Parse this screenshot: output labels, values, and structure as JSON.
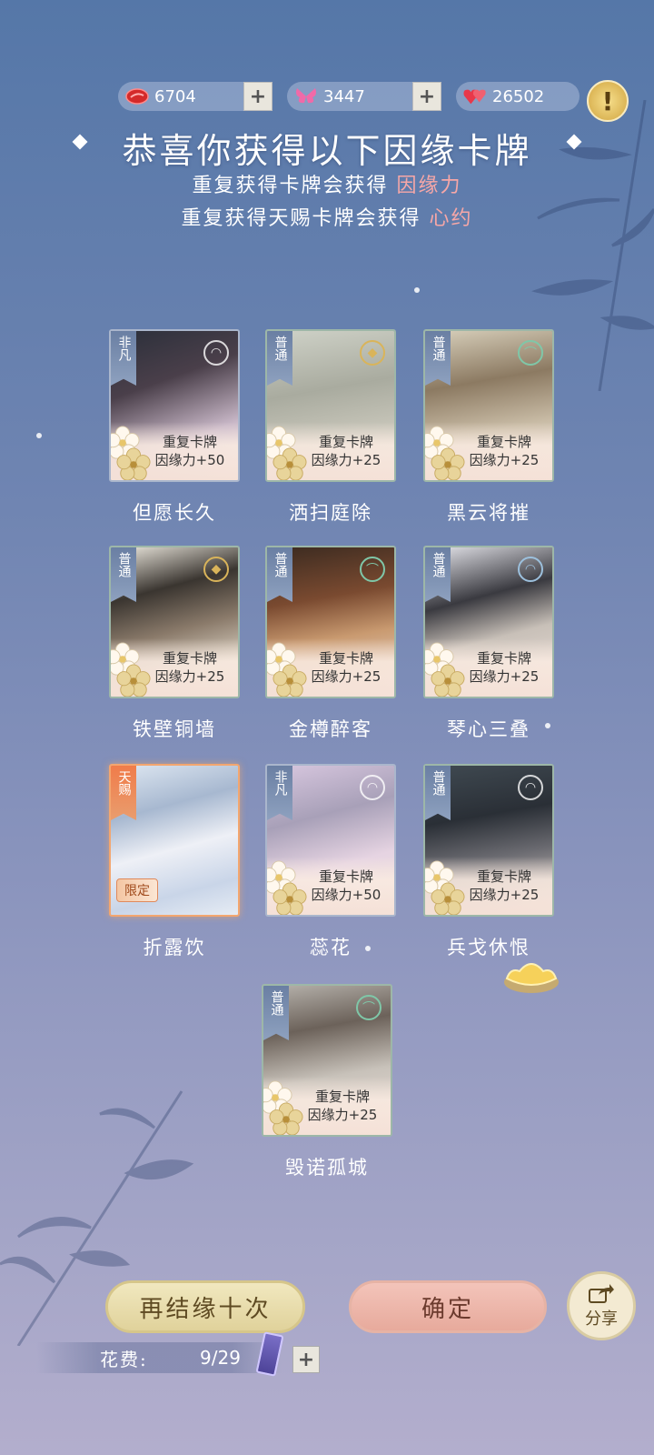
{
  "currency": {
    "red_gem": "6704",
    "butterfly": "3447",
    "hearts": "26502",
    "plus": "+",
    "alert": "!"
  },
  "header": {
    "title": "恭喜你获得以下因缘卡牌",
    "sub1_prefix": "重复获得卡牌会获得",
    "sub1_highlight": "因缘力",
    "sub2_prefix": "重复获得天赐卡牌会获得",
    "sub2_highlight": "心约"
  },
  "cards": [
    {
      "name": "但愿长久",
      "rarity": "非凡",
      "dup_line1": "重复卡牌",
      "dup_line2": "因缘力+50"
    },
    {
      "name": "洒扫庭除",
      "rarity": "普通",
      "dup_line1": "重复卡牌",
      "dup_line2": "因缘力+25"
    },
    {
      "name": "黑云将摧",
      "rarity": "普通",
      "dup_line1": "重复卡牌",
      "dup_line2": "因缘力+25"
    },
    {
      "name": "铁壁铜墙",
      "rarity": "普通",
      "dup_line1": "重复卡牌",
      "dup_line2": "因缘力+25"
    },
    {
      "name": "金樽醉客",
      "rarity": "普通",
      "dup_line1": "重复卡牌",
      "dup_line2": "因缘力+25"
    },
    {
      "name": "琴心三叠",
      "rarity": "普通",
      "dup_line1": "重复卡牌",
      "dup_line2": "因缘力+25"
    },
    {
      "name": "折露饮",
      "rarity": "天赐",
      "limited": "限定"
    },
    {
      "name": "蕊花",
      "rarity": "非凡",
      "dup_line1": "重复卡牌",
      "dup_line2": "因缘力+50"
    },
    {
      "name": "兵戈休恨",
      "rarity": "普通",
      "dup_line1": "重复卡牌",
      "dup_line2": "因缘力+25"
    },
    {
      "name": "毁诺孤城",
      "rarity": "普通",
      "dup_line1": "重复卡牌",
      "dup_line2": "因缘力+25"
    }
  ],
  "actions": {
    "again": "再结缘十次",
    "confirm": "确定",
    "share": "分享"
  },
  "cost": {
    "label": "花费:",
    "value": "9/29",
    "plus": "+"
  },
  "colors": {
    "highlight": "#f7a7a7",
    "normal_border": "#9db7a8",
    "legend_border": "#f3a66f"
  }
}
